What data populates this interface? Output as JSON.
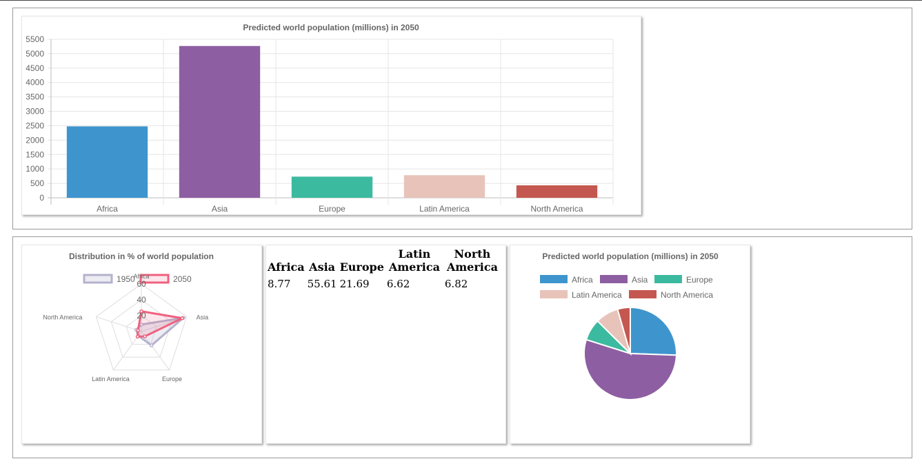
{
  "bar_chart": {
    "title": "Predicted world population (millions) in 2050",
    "y_ticks": [
      "5500",
      "5000",
      "4500",
      "4000",
      "3500",
      "3000",
      "2500",
      "2000",
      "1500",
      "1000",
      "500",
      "0"
    ]
  },
  "radar_chart": {
    "title": "Distribution in % of world population",
    "r_ticks": [
      "60",
      "40",
      "20"
    ]
  },
  "pie_chart": {
    "title": "Predicted world population (millions) in 2050"
  },
  "table": {
    "headers": [
      "Africa",
      "Asia",
      "Europe",
      "Latin America",
      "North America"
    ],
    "values": [
      "8.77",
      "55.61",
      "21.69",
      "6.62",
      "6.82"
    ]
  },
  "chart_data": [
    {
      "type": "bar",
      "title": "Predicted world population (millions) in 2050",
      "categories": [
        "Africa",
        "Asia",
        "Europe",
        "Latin America",
        "North America"
      ],
      "values": [
        2478,
        5267,
        734,
        784,
        433
      ],
      "colors": [
        "#3e95cd",
        "#8e5ea2",
        "#3cba9f",
        "#e8c3b9",
        "#c45850"
      ],
      "ylim": [
        0,
        5500
      ],
      "grid": true,
      "legend": "none"
    },
    {
      "type": "radar",
      "title": "Distribution in % of world population",
      "categories": [
        "Africa",
        "Asia",
        "Europe",
        "Latin America",
        "North America"
      ],
      "series": [
        {
          "name": "1950",
          "values": [
            8.77,
            55.61,
            21.69,
            6.62,
            6.82
          ],
          "color": "#b4b2cd"
        },
        {
          "name": "2050",
          "values": [
            25.48,
            54.16,
            7.61,
            8.06,
            4.45
          ],
          "color": "#f0607e"
        }
      ],
      "rlim": [
        0,
        60
      ],
      "legend": "top"
    },
    {
      "type": "pie",
      "title": "Predicted world population (millions) in 2050",
      "categories": [
        "Africa",
        "Asia",
        "Europe",
        "Latin America",
        "North America"
      ],
      "values": [
        2478,
        5267,
        734,
        784,
        433
      ],
      "colors": [
        "#3e95cd",
        "#8e5ea2",
        "#3cba9f",
        "#e8c3b9",
        "#c45850"
      ],
      "legend": "top"
    }
  ]
}
